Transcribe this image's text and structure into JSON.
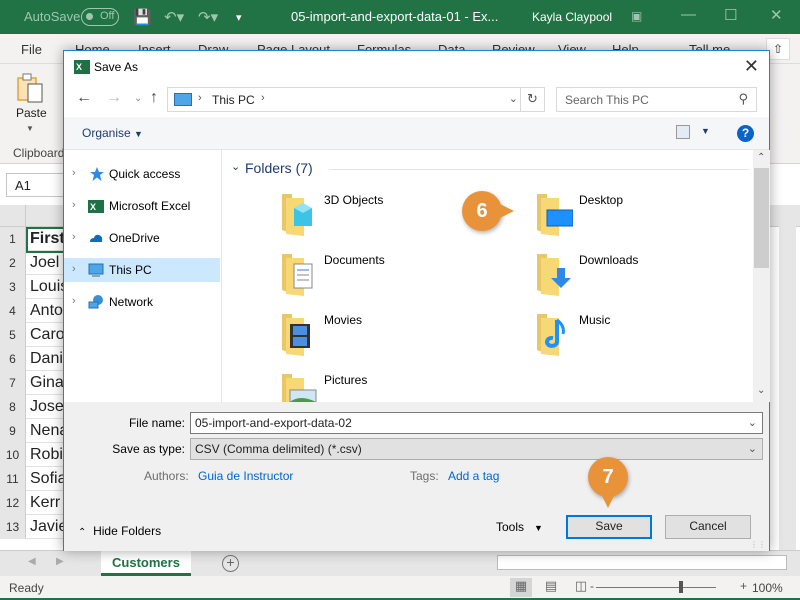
{
  "titlebar": {
    "autosave_label": "AutoSave",
    "autosave_state": "Off",
    "document_title": "05-import-and-export-data-01  -  Ex...",
    "user_name": "Kayla Claypool",
    "colors": {
      "brand": "#217346"
    }
  },
  "ribbon": {
    "tabs": [
      "File",
      "Home",
      "Insert",
      "Draw",
      "Page Layout",
      "Formulas",
      "Data",
      "Review",
      "View",
      "Help",
      "Tell me"
    ],
    "paste_label": "Paste",
    "clipboard_group": "Clipboard"
  },
  "namebox": {
    "value": "A1"
  },
  "sheet": {
    "rows": [
      {
        "num": "1",
        "value": "First"
      },
      {
        "num": "2",
        "value": "Joel"
      },
      {
        "num": "3",
        "value": "Louis"
      },
      {
        "num": "4",
        "value": "Anto"
      },
      {
        "num": "5",
        "value": "Caro"
      },
      {
        "num": "6",
        "value": "Dani"
      },
      {
        "num": "7",
        "value": "Gina"
      },
      {
        "num": "8",
        "value": "Jose"
      },
      {
        "num": "9",
        "value": "Nena"
      },
      {
        "num": "10",
        "value": "Robi"
      },
      {
        "num": "11",
        "value": "Sofia"
      },
      {
        "num": "12",
        "value": "Kerr"
      },
      {
        "num": "13",
        "value": "Javie"
      }
    ],
    "active_tab": "Customers"
  },
  "statusbar": {
    "status": "Ready",
    "zoom": "100%",
    "zoom_minus": "-",
    "zoom_plus": "+"
  },
  "dialog": {
    "title": "Save As",
    "address": {
      "location": "This PC"
    },
    "search_placeholder": "Search This PC",
    "organise_label": "Organise",
    "help_label": "?",
    "nav_items": [
      {
        "label": "Quick access",
        "icon": "star-icon"
      },
      {
        "label": "Microsoft Excel",
        "icon": "excel-icon"
      },
      {
        "label": "OneDrive",
        "icon": "cloud-icon"
      },
      {
        "label": "This PC",
        "icon": "computer-icon",
        "selected": true
      },
      {
        "label": "Network",
        "icon": "network-icon"
      }
    ],
    "folders_header": "Folders (7)",
    "folders": [
      {
        "label": "3D Objects",
        "icon": "3d-objects-folder-icon"
      },
      {
        "label": "Desktop",
        "icon": "desktop-folder-icon"
      },
      {
        "label": "Documents",
        "icon": "documents-folder-icon"
      },
      {
        "label": "Downloads",
        "icon": "downloads-folder-icon"
      },
      {
        "label": "Movies",
        "icon": "movies-folder-icon"
      },
      {
        "label": "Music",
        "icon": "music-folder-icon"
      },
      {
        "label": "Pictures",
        "icon": "pictures-folder-icon"
      }
    ],
    "file_name_label": "File name:",
    "file_name_value": "05-import-and-export-data-02",
    "save_type_label": "Save as type:",
    "save_type_value": "CSV (Comma delimited) (*.csv)",
    "authors_label": "Authors:",
    "authors_value": "Guia de Instructor",
    "tags_label": "Tags:",
    "tags_value": "Add a tag",
    "hide_folders_label": "Hide Folders",
    "tools_label": "Tools",
    "save_label": "Save",
    "cancel_label": "Cancel",
    "accent_color": "#0078d7"
  },
  "callouts": [
    {
      "number": "6",
      "color": "#e8923a"
    },
    {
      "number": "7",
      "color": "#e8923a"
    }
  ]
}
